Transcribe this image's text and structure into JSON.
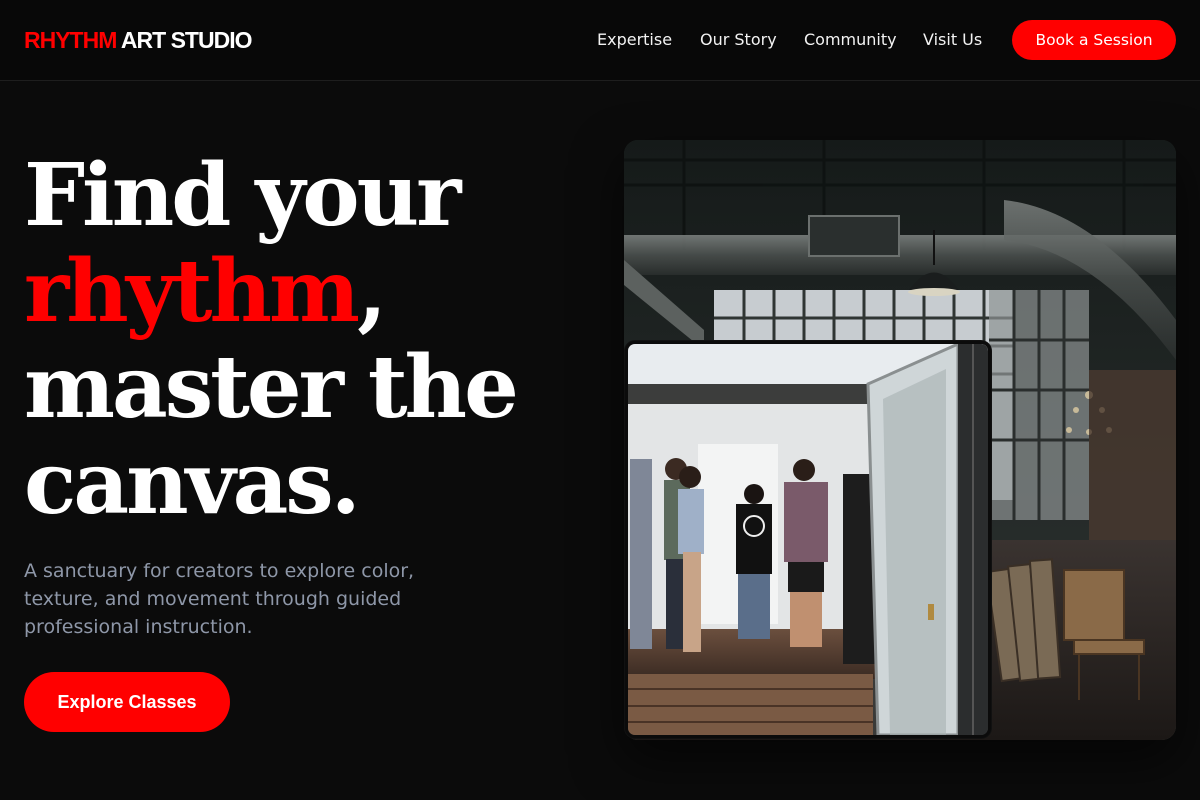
{
  "brand": {
    "accent": "RHYTHM",
    "rest": " ART STUDIO",
    "accent_color": "#ff0000"
  },
  "nav": {
    "items": [
      {
        "label": "Expertise"
      },
      {
        "label": "Our Story"
      },
      {
        "label": "Community"
      },
      {
        "label": "Visit Us"
      }
    ],
    "cta_label": "Book a Session"
  },
  "hero": {
    "title_line1": "Find your",
    "title_accent": "rhythm",
    "title_comma": ",",
    "title_line3": "master the",
    "title_line4": "canvas.",
    "subtitle": "A sanctuary for creators to explore color, texture, and movement through guided professional instruction.",
    "button_label": "Explore Classes"
  },
  "images": {
    "main_photo": "industrial-studio-photo",
    "inset_photo": "gallery-visitors-photo"
  },
  "colors": {
    "background": "#0b0b0b",
    "accent": "#ff0000",
    "muted_text": "#8e97a8"
  }
}
